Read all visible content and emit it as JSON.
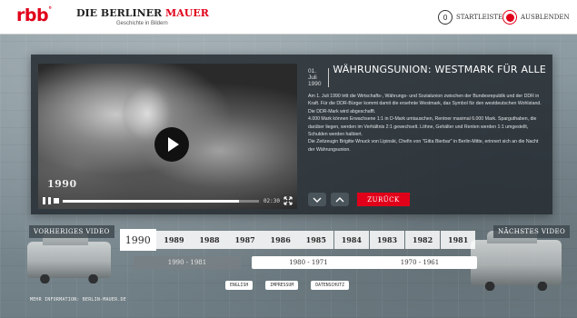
{
  "header": {
    "logo_rbb": "rbb",
    "logo_rbb_mark": "°",
    "logo_title_part1": "DIE BERLINER",
    "logo_title_part2": "MAUER",
    "logo_subtitle": "Geschichte in Bildern",
    "startleiste": {
      "icon_text": "0",
      "label": "STARTLEISTE"
    },
    "ausblenden": {
      "label": "AUSBLENDEN"
    }
  },
  "video": {
    "year_overlay": "1990",
    "time": "02:30",
    "progress": 0.9
  },
  "article": {
    "date": "01. Juli 1990",
    "title": "WÄHRUNGSUNION: WESTMARK FÜR ALLE",
    "paragraphs": [
      "Am 1. Juli 1990 tritt die Wirtschafts-, Währungs- und Sozialunion zwischen der Bundesrepublik und der DDR in Kraft. Für die DDR-Bürger kommt damit die ersehnte Westmark, das Symbol für den westdeutschen Wohlstand. Die DDR-Mark wird abgeschafft.",
      "4.000 Mark können Erwachsene 1:1 in D-Mark umtauschen, Rentner maximal 6.000 Mark. Sparguthaben, die darüber liegen, werden im Verhältnis 2:1 gewechselt. Löhne, Gehälter und Renten werden 1:1 umgestellt, Schulden werden halbiert.",
      "Die Zeitzeugin Brigitte Wnuck von Lipinski, Chefin von \"Gitta Bierbar\" in Berlin-Mitte, erinnert sich an die Nacht der Währungsunion."
    ],
    "back_label": "ZURÜCK"
  },
  "timeline": {
    "prev_label": "VORHERIGES VIDEO",
    "next_label": "NÄCHSTES VIDEO",
    "years": [
      "1990",
      "1989",
      "1988",
      "1987",
      "1986",
      "1985",
      "1984",
      "1983",
      "1982",
      "1981"
    ],
    "active_year": "1990",
    "ranges": [
      "1990 - 1981",
      "1980 - 1971",
      "1970 - 1961"
    ]
  },
  "footer": {
    "links": [
      "ENGLISH",
      "IMPRESSUM",
      "DATENSCHUTZ"
    ],
    "note": "MEHR INFORMATION: BERLIN-MAUER.DE"
  },
  "colors": {
    "accent_red": "#e1001a",
    "panel_bg": "#232a30"
  }
}
